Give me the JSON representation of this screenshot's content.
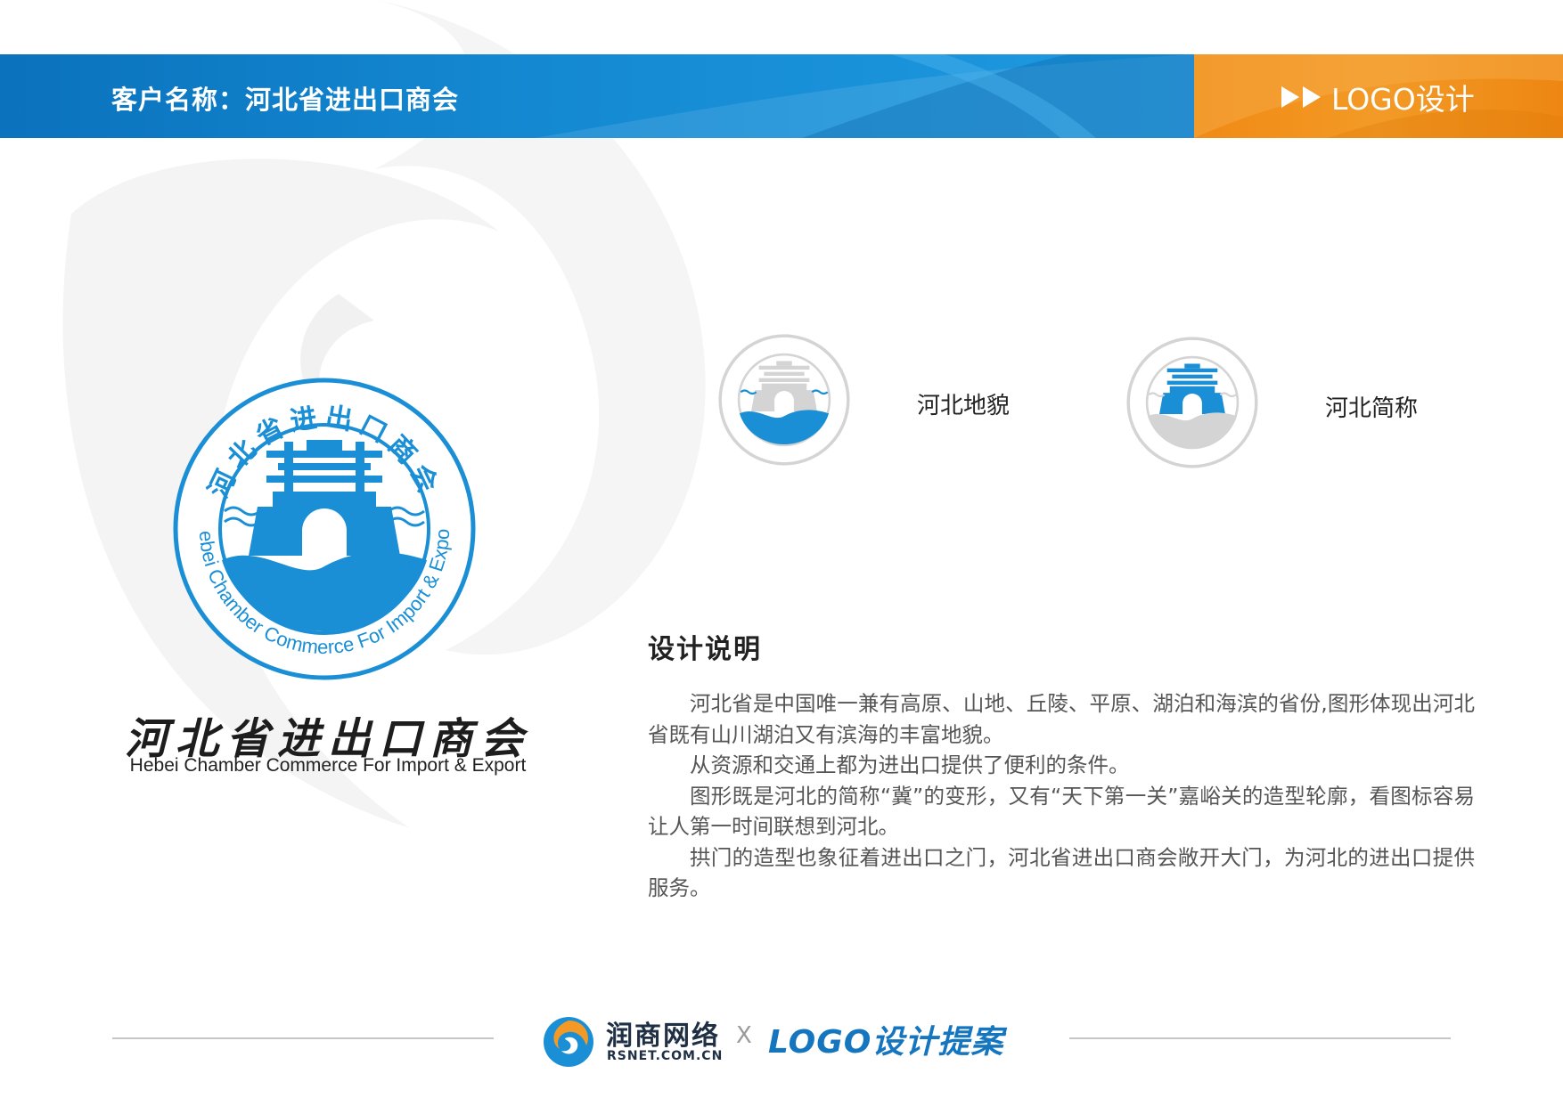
{
  "header": {
    "client_title": "客户名称：河北省进出口商会",
    "section_tag": "LOGO设计",
    "play_icon": "double-play-icon"
  },
  "logo": {
    "ring_text_cn": "河北省进出口商会",
    "ring_text_en": "Hebei Chamber Commerce For Import & Export",
    "emblem_glyph": "冀",
    "wordmark_cn": "河北省进出口商会",
    "wordmark_en": "Hebei Chamber Commerce For Import & Export",
    "colors": {
      "primary_blue": "#1a8fd6",
      "grey_ghost": "#d4d4d4"
    }
  },
  "variants": [
    {
      "label": "河北地貌",
      "highlight": "terrain-wave"
    },
    {
      "label": "河北简称",
      "highlight": "ji-gate"
    }
  ],
  "description": {
    "heading": "设计说明",
    "paragraphs": [
      "河北省是中国唯一兼有高原、山地、丘陵、平原、湖泊和海滨的省份,图形体现出河北省既有山川湖泊又有滨海的丰富地貌。",
      "从资源和交通上都为进出口提供了便利的条件。",
      "图形既是河北的简称“冀”的变形，又有“天下第一关”嘉峪关的造型轮廓，看图标容易让人第一时间联想到河北。",
      "拱门的造型也象征着进出口之门，河北省进出口商会敞开大门，为河北的进出口提供服务。"
    ]
  },
  "footer": {
    "brand_name": "润商网络",
    "brand_domain": "RSNET.COM.CN",
    "separator": "X",
    "proposal": "LOGO设计提案",
    "brand_icon": "rsnet-swirl-logo-icon"
  },
  "colors": {
    "header_blue": "#0b72bd",
    "header_orange": "#f39a26",
    "accent_blue": "#1576bf"
  }
}
